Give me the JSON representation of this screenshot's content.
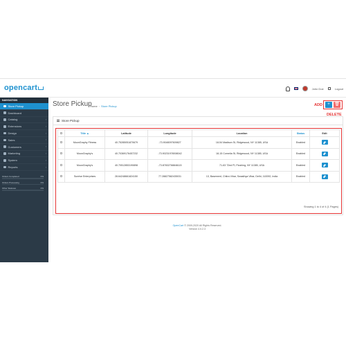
{
  "header": {
    "logo_text": "opencart",
    "user_name": "John Doe",
    "logout_label": "Logout",
    "colors": {
      "brand": "#1e91cf",
      "sidebar": "#2b3a47"
    }
  },
  "sidebar": {
    "heading": "NAVIGATION",
    "items": [
      {
        "label": "Store Pickup",
        "icon": "pin-icon",
        "active": true
      },
      {
        "label": "Dashboard",
        "icon": "dashboard-icon"
      },
      {
        "label": "Catalog",
        "icon": "tag-icon"
      },
      {
        "label": "Extensions",
        "icon": "puzzle-icon"
      },
      {
        "label": "Design",
        "icon": "monitor-icon"
      },
      {
        "label": "Sales",
        "icon": "cart-icon"
      },
      {
        "label": "Customers",
        "icon": "user-icon"
      },
      {
        "label": "Marketing",
        "icon": "share-icon"
      },
      {
        "label": "System",
        "icon": "gear-icon"
      },
      {
        "label": "Reports",
        "icon": "bar-chart-icon"
      }
    ],
    "status": [
      {
        "label": "Orders Completed",
        "value": "0%"
      },
      {
        "label": "Orders Processing",
        "value": "0%"
      },
      {
        "label": "Other Statuses",
        "value": "0%"
      }
    ]
  },
  "page": {
    "title": "Store Pickup",
    "breadcrumb_home": "Home",
    "breadcrumb_current": "Store Pickup",
    "add_button": "+",
    "delete_button": "🗑",
    "annotation_add": "ADD",
    "annotation_delete": "DELETE"
  },
  "panel": {
    "title": "Store Pickup",
    "columns": [
      "Title ▲",
      "Latitude",
      "Longitude",
      "Location",
      "Status",
      "Edit"
    ],
    "rows": [
      {
        "title": "MoonGraphy Fitness",
        "latitude": "40.75285051870679",
        "longitude": "-73.9048097609827",
        "location": "18-54 Madison St, Ridgewood, NY 11385, USA",
        "status": "Enabled"
      },
      {
        "title": "MoonGraphy's",
        "latitude": "40.70369176457232",
        "longitude": "-73.90231978008042",
        "location": "18-15 Cornelia St, Ridgewood, NY 11385, USA",
        "status": "Enabled"
      },
      {
        "title": "MoonGraphy's",
        "latitude": "40.70512853190898",
        "longitude": "-73.87832768846115",
        "location": "71-63 72nd Pl, Flushing, NY 11385, USA",
        "status": "Enabled"
      },
      {
        "title": "Sunrise Enterprises",
        "latitude": "28.64248661824150",
        "longitude": "77.28827582435031",
        "location": "13, Basement, Chitra Vihar, Swasthya Vihar, Delhi, 110092, India",
        "status": "Enabled"
      }
    ],
    "paging": "Showing 1 to 4 of 4 (1 Pages)"
  },
  "footer": {
    "brand": "OpenCart",
    "copyright": " © 2009-2020 All Rights Reserved.",
    "version": "Version 4.0.2.3"
  }
}
